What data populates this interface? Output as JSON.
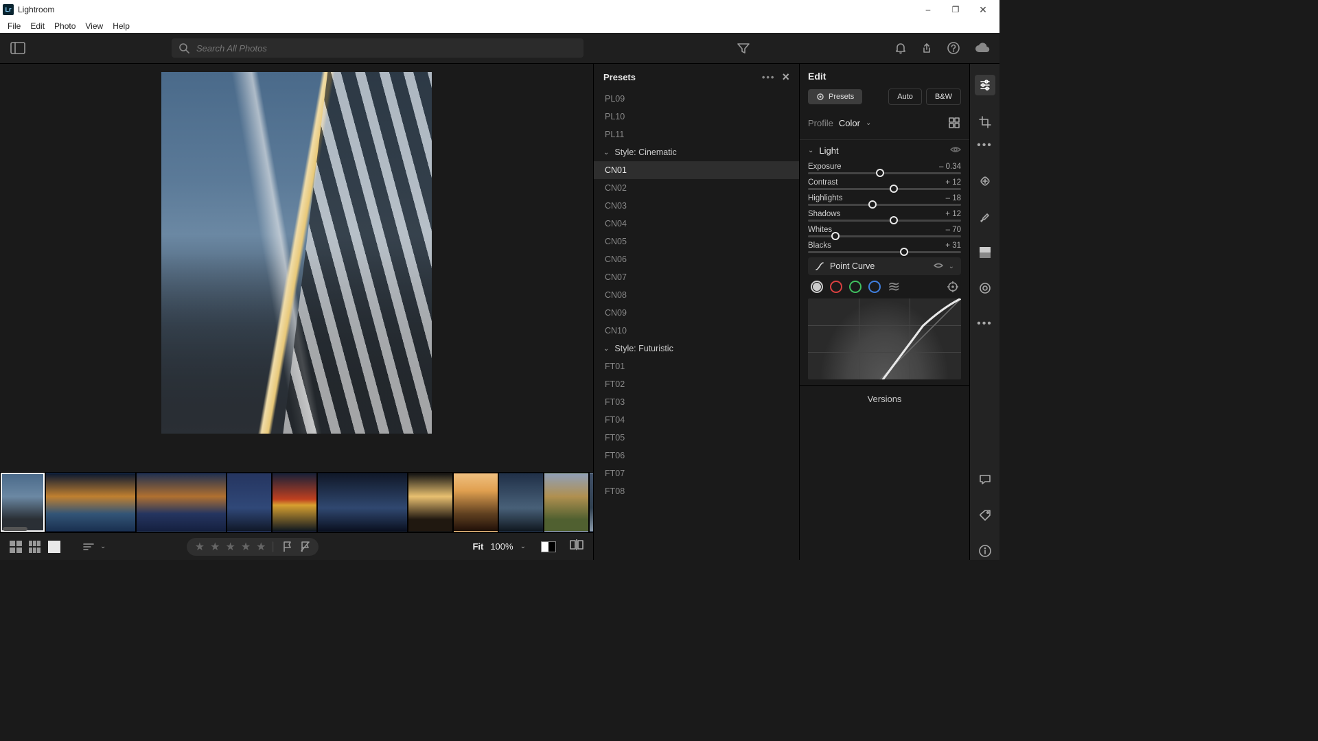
{
  "app": {
    "title": "Lightroom"
  },
  "window": {
    "minimize": "–",
    "maximize": "❐",
    "close": "✕"
  },
  "menu": [
    "File",
    "Edit",
    "Photo",
    "View",
    "Help"
  ],
  "search": {
    "placeholder": "Search All Photos"
  },
  "presets": {
    "title": "Presets",
    "before_items": [
      "PL09",
      "PL10",
      "PL11"
    ],
    "groups": [
      {
        "label": "Style: Cinematic",
        "items": [
          "CN01",
          "CN02",
          "CN03",
          "CN04",
          "CN05",
          "CN06",
          "CN07",
          "CN08",
          "CN09",
          "CN10"
        ],
        "selected": "CN01"
      },
      {
        "label": "Style: Futuristic",
        "items": [
          "FT01",
          "FT02",
          "FT03",
          "FT04",
          "FT05",
          "FT06",
          "FT07",
          "FT08"
        ]
      }
    ]
  },
  "edit": {
    "title": "Edit",
    "buttons": {
      "presets": "Presets",
      "auto": "Auto",
      "bw": "B&W"
    },
    "profile": {
      "label": "Profile",
      "value": "Color"
    },
    "light": {
      "title": "Light",
      "sliders": [
        {
          "name": "Exposure",
          "value": "– 0.34",
          "pos": 47
        },
        {
          "name": "Contrast",
          "value": "+ 12",
          "pos": 56
        },
        {
          "name": "Highlights",
          "value": "– 18",
          "pos": 42
        },
        {
          "name": "Shadows",
          "value": "+ 12",
          "pos": 56
        },
        {
          "name": "Whites",
          "value": "– 70",
          "pos": 18
        },
        {
          "name": "Blacks",
          "value": "+ 31",
          "pos": 63
        }
      ]
    },
    "curve": {
      "title": "Point Curve"
    },
    "versions": "Versions"
  },
  "bottom": {
    "fit": "Fit",
    "zoom": "100%"
  },
  "thumbs": 11
}
